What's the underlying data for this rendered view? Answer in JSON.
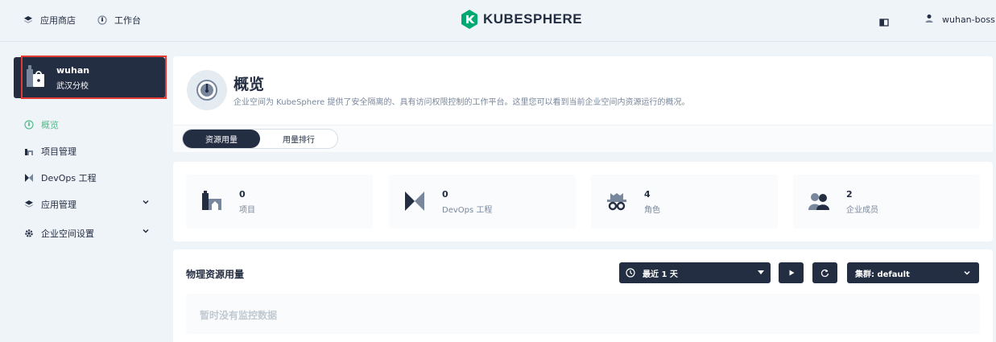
{
  "topbar": {
    "app_store": "应用商店",
    "workbench": "工作台",
    "brand": "KUBESPHERE",
    "username": "wuhan-boss"
  },
  "workspace": {
    "name": "wuhan",
    "description": "武汉分校"
  },
  "sidebar": {
    "items": [
      {
        "label": "概览",
        "icon": "dashboard-icon",
        "active": true
      },
      {
        "label": "项目管理",
        "icon": "project-icon"
      },
      {
        "label": "DevOps 工程",
        "icon": "devops-icon"
      },
      {
        "label": "应用管理",
        "icon": "app-icon",
        "expandable": true
      },
      {
        "label": "企业空间设置",
        "icon": "gear-icon",
        "expandable": true
      }
    ]
  },
  "header": {
    "title": "概览",
    "description": "企业空间为 KubeSphere 提供了安全隔离的、具有访问权限控制的工作平台。这里您可以看到当前企业空间内资源运行的概况。",
    "tabs": [
      {
        "label": "资源用量",
        "active": true
      },
      {
        "label": "用量排行",
        "active": false
      }
    ]
  },
  "stats": [
    {
      "value": "0",
      "label": "项目",
      "icon": "project-icon"
    },
    {
      "value": "0",
      "label": "DevOps 工程",
      "icon": "devops-icon"
    },
    {
      "value": "4",
      "label": "角色",
      "icon": "role-icon"
    },
    {
      "value": "2",
      "label": "企业成员",
      "icon": "members-icon"
    }
  ],
  "resources": {
    "title": "物理资源用量",
    "time_range": "最近 1 天",
    "cluster": "集群: default",
    "empty": "暂时没有监控数据"
  },
  "colors": {
    "accent": "#55bc8a",
    "dark": "#242e42",
    "highlight": "#e53935"
  }
}
